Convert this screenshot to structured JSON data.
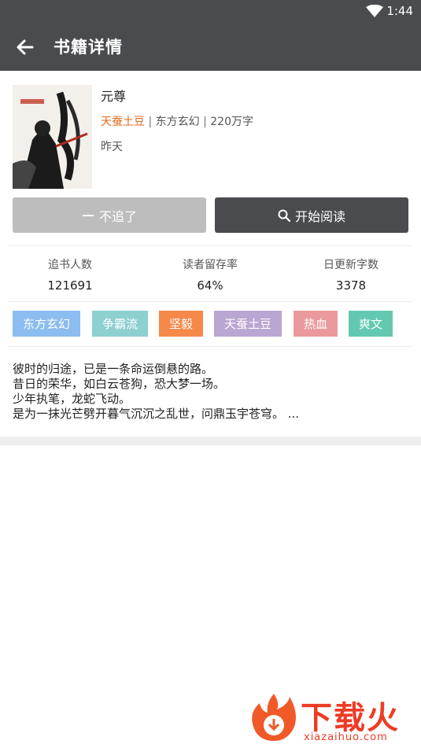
{
  "status_bar": {
    "time": "1:44",
    "icon": "wifi-icon"
  },
  "app_bar": {
    "title": "书籍详情",
    "back_icon": "arrow-left-icon"
  },
  "book": {
    "title": "元尊",
    "author": "天蚕土豆",
    "category": "东方玄幻",
    "word_count": "220万字",
    "separator": "|",
    "updated": "昨天"
  },
  "actions": {
    "unfollow_label": "不追了",
    "read_label": "开始阅读"
  },
  "stats": [
    {
      "label": "追书人数",
      "value": "121691"
    },
    {
      "label": "读者留存率",
      "value": "64%"
    },
    {
      "label": "日更新字数",
      "value": "3378"
    }
  ],
  "tags": [
    {
      "label": "东方玄幻",
      "color": "#8bbdf0"
    },
    {
      "label": "争霸流",
      "color": "#8ecfd0"
    },
    {
      "label": "坚毅",
      "color": "#f5894a"
    },
    {
      "label": "天蚕土豆",
      "color": "#b9a6d2"
    },
    {
      "label": "热血",
      "color": "#ea9a9c"
    },
    {
      "label": "爽文",
      "color": "#62c9b0"
    }
  ],
  "description": [
    "彼时的归途，已是一条命运倒悬的路。",
    "昔日的荣华，如白云苍狗，恐大梦一场。",
    "少年执笔，龙蛇飞动。",
    "是为一抹光芒劈开暮气沉沉之乱世，问鼎玉宇苍穹。 ..."
  ],
  "watermark": {
    "text": "下载火",
    "sub": "xiazaihuo.com"
  }
}
